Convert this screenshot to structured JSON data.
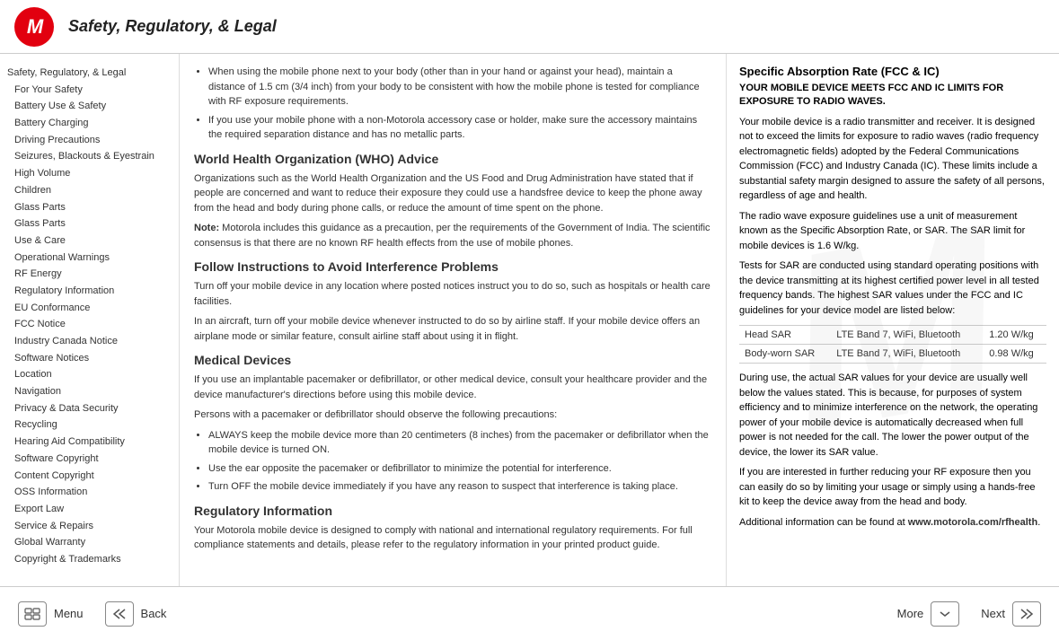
{
  "header": {
    "title": "Safety, Regulatory, & Legal",
    "logo_letter": "M"
  },
  "sidebar": {
    "items": [
      {
        "label": "Safety, Regulatory, & Legal",
        "indent": 0
      },
      {
        "label": "For Your Safety",
        "indent": 1
      },
      {
        "label": "Battery Use & Safety",
        "indent": 1
      },
      {
        "label": "Battery Charging",
        "indent": 1
      },
      {
        "label": "Driving Precautions",
        "indent": 1
      },
      {
        "label": "Seizures, Blackouts & Eyestrain",
        "indent": 1
      },
      {
        "label": "High Volume",
        "indent": 1
      },
      {
        "label": "Children",
        "indent": 1
      },
      {
        "label": "Glass Parts",
        "indent": 1
      },
      {
        "label": "Glass Parts",
        "indent": 1
      },
      {
        "label": "Use & Care",
        "indent": 1
      },
      {
        "label": "Operational Warnings",
        "indent": 1
      },
      {
        "label": "RF Energy",
        "indent": 1
      },
      {
        "label": "Regulatory Information",
        "indent": 1
      },
      {
        "label": "EU Conformance",
        "indent": 1
      },
      {
        "label": "FCC Notice",
        "indent": 1
      },
      {
        "label": "Industry Canada Notice",
        "indent": 1
      },
      {
        "label": "Software Notices",
        "indent": 1
      },
      {
        "label": "Location",
        "indent": 1
      },
      {
        "label": "Navigation",
        "indent": 1
      },
      {
        "label": "Privacy & Data Security",
        "indent": 1
      },
      {
        "label": "Recycling",
        "indent": 1
      },
      {
        "label": "Hearing Aid Compatibility",
        "indent": 1
      },
      {
        "label": "Software Copyright",
        "indent": 1
      },
      {
        "label": "Content Copyright",
        "indent": 1
      },
      {
        "label": "OSS Information",
        "indent": 1
      },
      {
        "label": "Export Law",
        "indent": 1
      },
      {
        "label": "Service & Repairs",
        "indent": 1
      },
      {
        "label": "Global Warranty",
        "indent": 1
      },
      {
        "label": "Copyright & Trademarks",
        "indent": 1
      }
    ]
  },
  "content": {
    "bullet1": "When using the mobile phone next to your body (other than in your hand or against your head), maintain a distance of 1.5 cm (3/4 inch) from your body to be consistent with how the mobile phone is tested for compliance with RF exposure requirements.",
    "bullet2": "If you use your mobile phone with a non-Motorola accessory case or holder, make sure the accessory maintains the required separation distance and has no metallic parts.",
    "who_title": "World Health Organization (WHO) Advice",
    "who_text": "Organizations such as the World Health Organization and the US Food and Drug Administration have stated that if people are concerned and want to reduce their exposure they could use a handsfree device to keep the phone away from the head and body during phone calls, or reduce the amount of time spent on the phone.",
    "who_note_label": "Note:",
    "who_note": " Motorola includes this guidance as a precaution, per the requirements of the Government of India. The scientific consensus is that there are no known RF health effects from the use of mobile phones.",
    "follow_title": "Follow Instructions to Avoid Interference Problems",
    "follow_p1": "Turn off your mobile device in any location where posted notices instruct you to do so, such as hospitals or health care facilities.",
    "follow_p2": "In an aircraft, turn off your mobile device whenever instructed to do so by airline staff. If your mobile device offers an airplane mode or similar feature, consult airline staff about using it in flight.",
    "medical_title": "Medical Devices",
    "medical_p1": "If you use an implantable pacemaker or defibrillator, or other medical device, consult your healthcare provider and the device manufacturer's directions before using this mobile device.",
    "medical_p2": "Persons with a pacemaker or defibrillator should observe the following precautions:",
    "medical_b1": "ALWAYS keep the mobile device more than 20 centimeters (8 inches) from the pacemaker or defibrillator when the mobile device is turned ON.",
    "medical_b2": "Use the ear opposite the pacemaker or defibrillator to minimize the potential for interference.",
    "medical_b3": "Turn OFF the mobile device immediately if you have any reason to suspect that interference is taking place.",
    "reg_title": "Regulatory Information",
    "reg_text": "Your Motorola mobile device is designed to comply with national and international regulatory requirements. For full compliance statements and details, please refer to the regulatory information in your printed product guide."
  },
  "right_panel": {
    "sar_title": "Specific Absorption Rate (FCC & IC)",
    "sar_subtitle": "YOUR MOBILE DEVICE MEETS FCC AND IC LIMITS FOR EXPOSURE TO RADIO WAVES.",
    "sar_p1": "Your mobile device is a radio transmitter and receiver. It is designed not to exceed the limits for exposure to radio waves (radio frequency electromagnetic fields) adopted by the Federal Communications Commission (FCC) and Industry Canada (IC). These limits include a substantial safety margin designed to assure the safety of all persons, regardless of age and health.",
    "sar_p2": "The radio wave exposure guidelines use a unit of measurement known as the Specific Absorption Rate, or SAR. The SAR limit for mobile devices is 1.6 W/kg.",
    "sar_p3": "Tests for SAR are conducted using standard operating positions with the device transmitting at its highest certified power level in all tested frequency bands. The highest SAR values under the FCC and IC guidelines for your device model are listed below:",
    "table": {
      "rows": [
        {
          "label": "Head SAR",
          "tech": "LTE Band 7, WiFi, Bluetooth",
          "value": "1.20 W/kg"
        },
        {
          "label": "Body-worn SAR",
          "tech": "LTE Band 7, WiFi, Bluetooth",
          "value": "0.98 W/kg"
        }
      ]
    },
    "sar_p4": "During use, the actual SAR values for your device are usually well below the values stated. This is because, for purposes of system efficiency and to minimize interference on the network, the operating power of your mobile device is automatically decreased when full power is not needed for the call. The lower the power output of the device, the lower its SAR value.",
    "sar_p5": "If you are interested in further reducing your RF exposure then you can easily do so by limiting your usage or simply using a hands-free kit to keep the device away from the head and body.",
    "sar_p6_prefix": "Additional information can be found at ",
    "sar_link": "www.motorola.com/rfhealth",
    "sar_p6_suffix": "."
  },
  "footer": {
    "menu_label": "Menu",
    "back_label": "Back",
    "more_label": "More",
    "next_label": "Next"
  }
}
